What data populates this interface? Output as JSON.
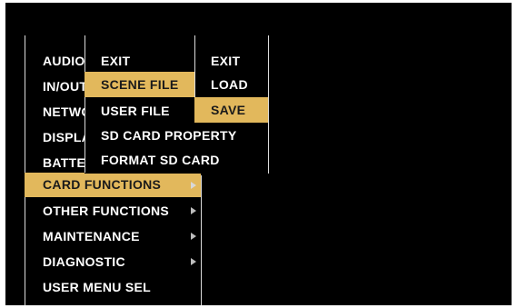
{
  "main_menu": {
    "items": [
      {
        "label": "AUDIO",
        "has_submenu": true
      },
      {
        "label": "IN/OUT",
        "has_submenu": true
      },
      {
        "label": "NETWORK",
        "has_submenu": true
      },
      {
        "label": "DISPLAY",
        "has_submenu": true
      },
      {
        "label": "BATTERY",
        "has_submenu": true
      },
      {
        "label": "CARD FUNCTIONS",
        "has_submenu": true,
        "selected": true
      },
      {
        "label": "OTHER FUNCTIONS",
        "has_submenu": true
      },
      {
        "label": "MAINTENANCE",
        "has_submenu": true
      },
      {
        "label": "DIAGNOSTIC",
        "has_submenu": true
      },
      {
        "label": "USER MENU SEL",
        "has_submenu": false
      }
    ]
  },
  "card_functions_menu": {
    "items": [
      {
        "label": "EXIT"
      },
      {
        "label": "SCENE FILE",
        "selected": true
      },
      {
        "label": "USER FILE"
      },
      {
        "label": "SD CARD PROPERTY"
      },
      {
        "label": "FORMAT SD CARD"
      }
    ]
  },
  "scene_file_menu": {
    "items": [
      {
        "label": "EXIT"
      },
      {
        "label": "LOAD"
      },
      {
        "label": "SAVE",
        "selected": true
      }
    ]
  },
  "colors": {
    "background": "#000000",
    "text": "#ffffff",
    "highlight": "#e2b85c",
    "highlight_text": "#1a1a1a",
    "divider": "#dcdcdc"
  },
  "icons": {
    "submenu_indicator": "triangle-right-icon"
  }
}
